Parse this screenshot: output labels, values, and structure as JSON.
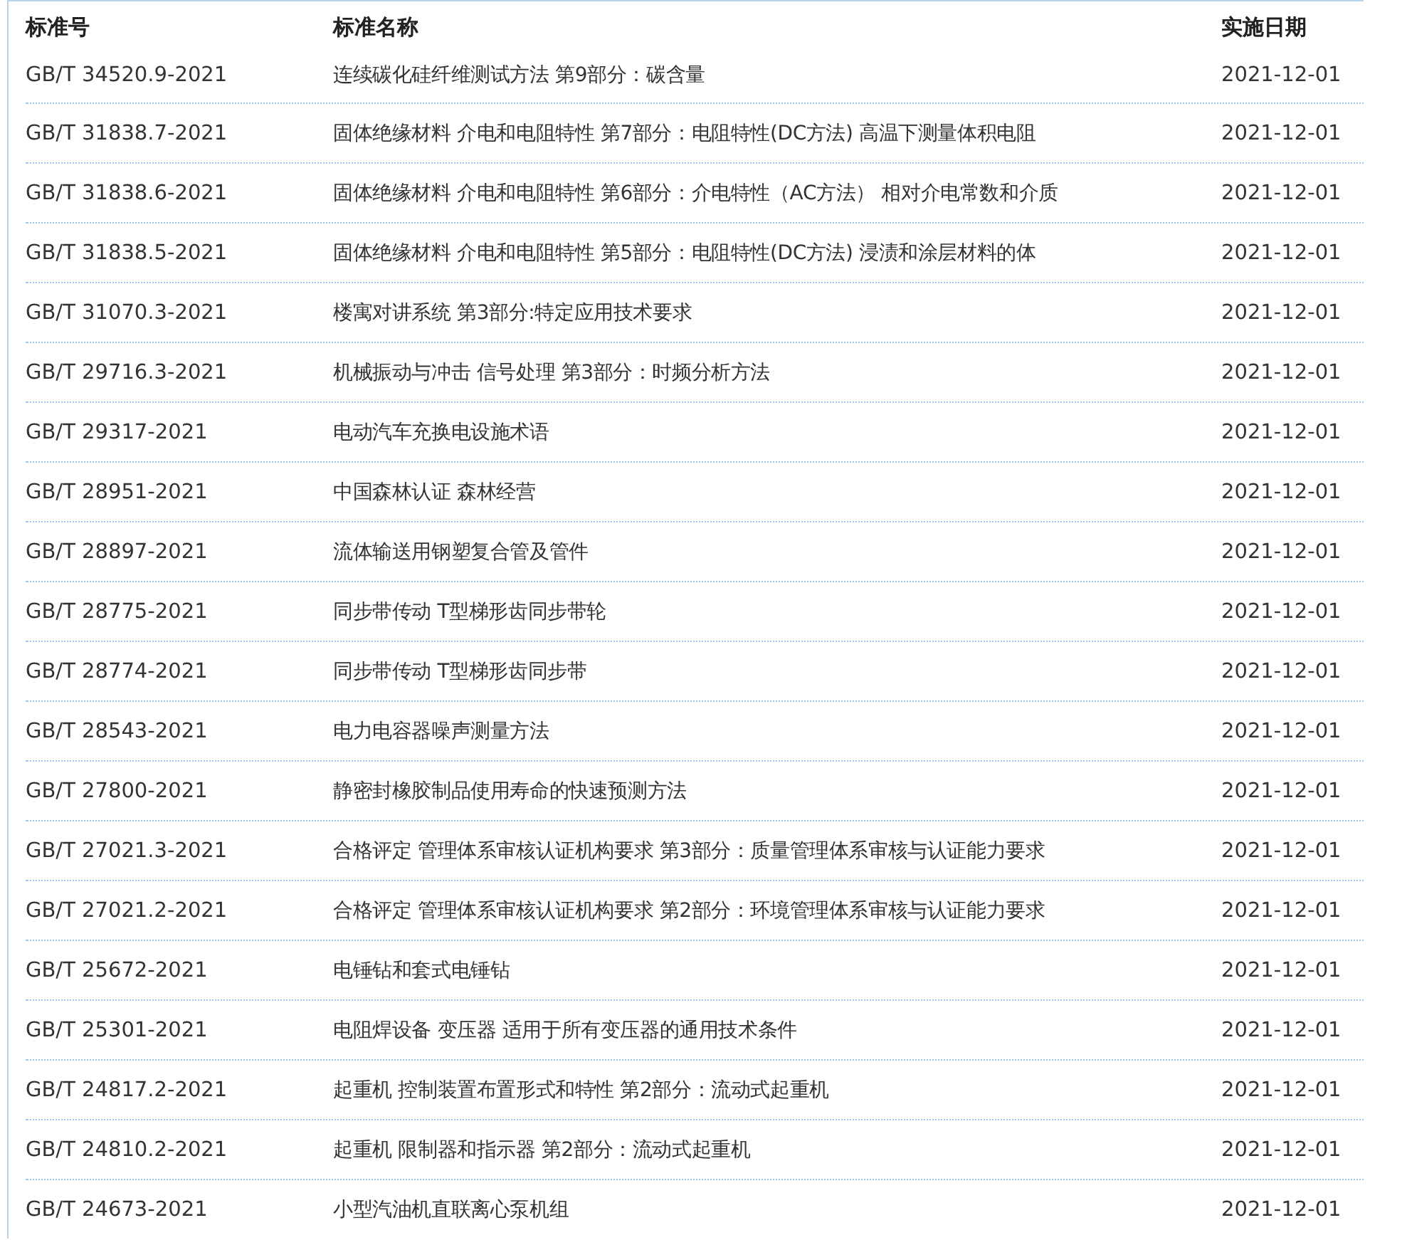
{
  "table": {
    "columns": [
      "标准号",
      "标准名称",
      "实施日期"
    ],
    "rows": [
      {
        "code": "GB/T 34520.9-2021",
        "name": "连续碳化硅纤维测试方法 第9部分：碳含量",
        "date": "2021-12-01"
      },
      {
        "code": "GB/T 31838.7-2021",
        "name": "固体绝缘材料 介电和电阻特性 第7部分：电阻特性(DC方法) 高温下测量体积电阻",
        "date": "2021-12-01"
      },
      {
        "code": "GB/T 31838.6-2021",
        "name": "固体绝缘材料 介电和电阻特性 第6部分：介电特性（AC方法） 相对介电常数和介质",
        "date": "2021-12-01"
      },
      {
        "code": "GB/T 31838.5-2021",
        "name": "固体绝缘材料 介电和电阻特性 第5部分：电阻特性(DC方法) 浸渍和涂层材料的体",
        "date": "2021-12-01"
      },
      {
        "code": "GB/T 31070.3-2021",
        "name": "楼寓对讲系统 第3部分:特定应用技术要求",
        "date": "2021-12-01"
      },
      {
        "code": "GB/T 29716.3-2021",
        "name": "机械振动与冲击 信号处理 第3部分：时频分析方法",
        "date": "2021-12-01"
      },
      {
        "code": "GB/T 29317-2021",
        "name": "电动汽车充换电设施术语",
        "date": "2021-12-01"
      },
      {
        "code": "GB/T 28951-2021",
        "name": "中国森林认证 森林经营",
        "date": "2021-12-01"
      },
      {
        "code": "GB/T 28897-2021",
        "name": "流体输送用钢塑复合管及管件",
        "date": "2021-12-01"
      },
      {
        "code": "GB/T 28775-2021",
        "name": "同步带传动 T型梯形齿同步带轮",
        "date": "2021-12-01"
      },
      {
        "code": "GB/T 28774-2021",
        "name": "同步带传动 T型梯形齿同步带",
        "date": "2021-12-01"
      },
      {
        "code": "GB/T 28543-2021",
        "name": "电力电容器噪声测量方法",
        "date": "2021-12-01"
      },
      {
        "code": "GB/T 27800-2021",
        "name": "静密封橡胶制品使用寿命的快速预测方法",
        "date": "2021-12-01"
      },
      {
        "code": "GB/T 27021.3-2021",
        "name": "合格评定 管理体系审核认证机构要求 第3部分：质量管理体系审核与认证能力要求",
        "date": "2021-12-01"
      },
      {
        "code": "GB/T 27021.2-2021",
        "name": "合格评定 管理体系审核认证机构要求 第2部分：环境管理体系审核与认证能力要求",
        "date": "2021-12-01"
      },
      {
        "code": "GB/T 25672-2021",
        "name": "电锤钻和套式电锤钻",
        "date": "2021-12-01"
      },
      {
        "code": "GB/T 25301-2021",
        "name": "电阻焊设备 变压器 适用于所有变压器的通用技术条件",
        "date": "2021-12-01"
      },
      {
        "code": "GB/T 24817.2-2021",
        "name": "起重机 控制装置布置形式和特性 第2部分：流动式起重机",
        "date": "2021-12-01"
      },
      {
        "code": "GB/T 24810.2-2021",
        "name": "起重机 限制器和指示器 第2部分：流动式起重机",
        "date": "2021-12-01"
      },
      {
        "code": "GB/T 24673-2021",
        "name": "小型汽油机直联离心泵机组",
        "date": "2021-12-01"
      }
    ]
  }
}
